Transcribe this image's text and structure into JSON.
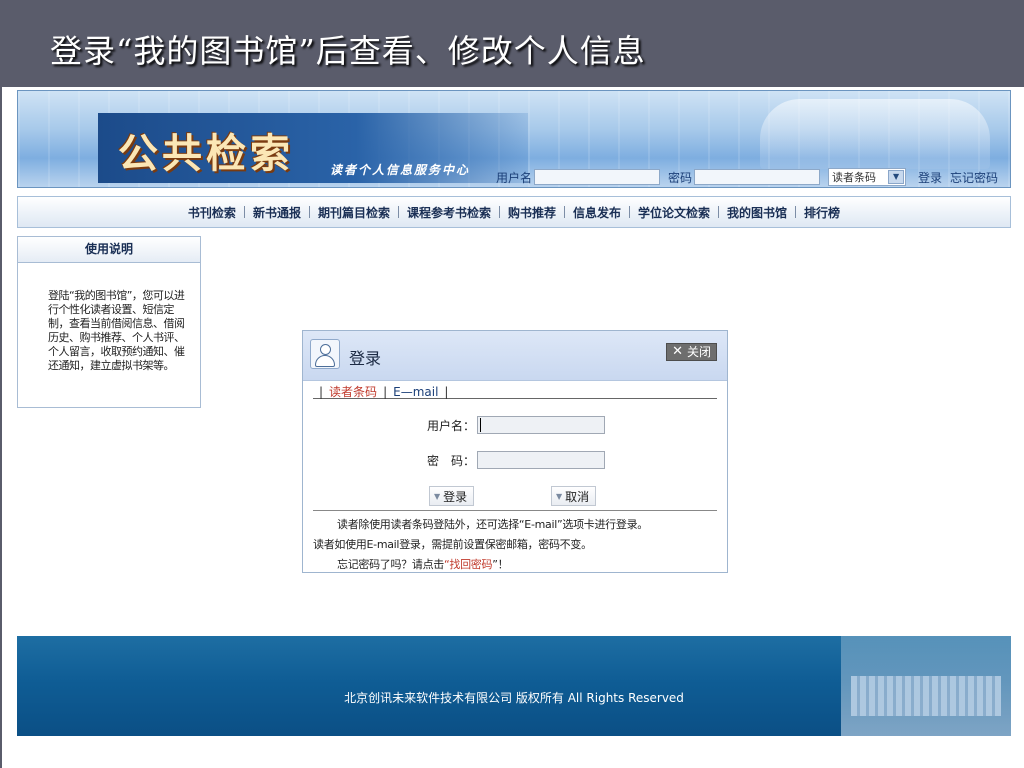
{
  "slide": {
    "title": "登录“我的图书馆”后查看、修改个人信息"
  },
  "banner": {
    "logo": "公共检索",
    "subtitle": "读者个人信息服务中心",
    "username_label": "用户名",
    "password_label": "密码",
    "type_select_value": "读者条码",
    "login_link": "登录",
    "forgot_link": "忘记密码"
  },
  "nav": {
    "items": [
      "书刊检索",
      "新书通报",
      "期刊篇目检索",
      "课程参考书检索",
      "购书推荐",
      "信息发布",
      "学位论文检索",
      "我的图书馆",
      "排行榜"
    ]
  },
  "sidebar": {
    "heading": "使用说明",
    "text": "登陆“我的图书馆”，您可以进行个性化读者设置、短信定制，查看当前借阅信息、借阅历史、购书推荐、个人书评、个人留言，收取预约通知、催还通知，建立虚拟书架等。"
  },
  "dialog": {
    "title": "登录",
    "close_label": "关闭",
    "tab_barcode": "读者条码",
    "tab_email": "E—mail",
    "tab_separator": "|",
    "username_label": "用户名：",
    "password_label": "密　码：",
    "login_button": "登录",
    "cancel_button": "取消",
    "note1": "读者除使用读者条码登陆外，还可选择“E-mail”选项卡进行登录。",
    "note2": "读者如使用E-mail登录，需提前设置保密邮箱，密码不变。",
    "note3_prefix": "忘记密码了吗？请点击",
    "note3_open_quote": "“",
    "note3_link": "找回密码",
    "note3_suffix": "”！"
  },
  "footer": {
    "copyright": "北京创讯未来软件技术有限公司 版权所有 All Rights Reserved"
  }
}
